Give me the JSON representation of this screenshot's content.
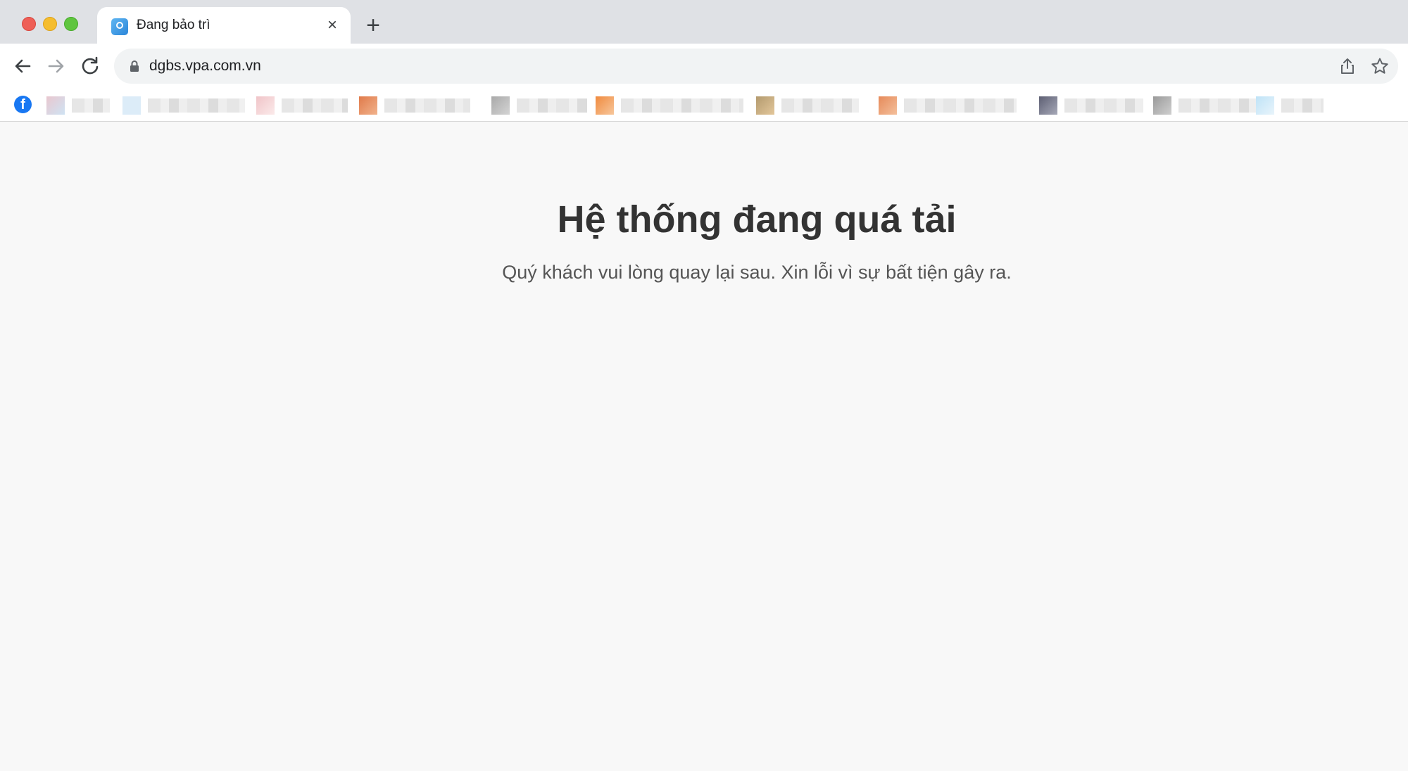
{
  "browser": {
    "tab": {
      "title": "Đang bảo trì",
      "close_glyph": "×",
      "favicon": "vpa-logo-icon"
    },
    "new_tab_glyph": "+",
    "address_bar": {
      "url": "dgbs.vpa.com.vn"
    },
    "bookmarks_bar": {
      "first_icon": "facebook-icon",
      "first_glyph": "f"
    }
  },
  "page": {
    "heading": "Hệ thống đang quá tải",
    "message": "Quý khách vui lòng quay lại sau. Xin lỗi vì sự bất tiện gây ra."
  },
  "colors": {
    "tab_strip": "#dfe1e5",
    "page_background": "#f8f8f8",
    "heading_text": "#333333",
    "message_text": "#555555"
  }
}
